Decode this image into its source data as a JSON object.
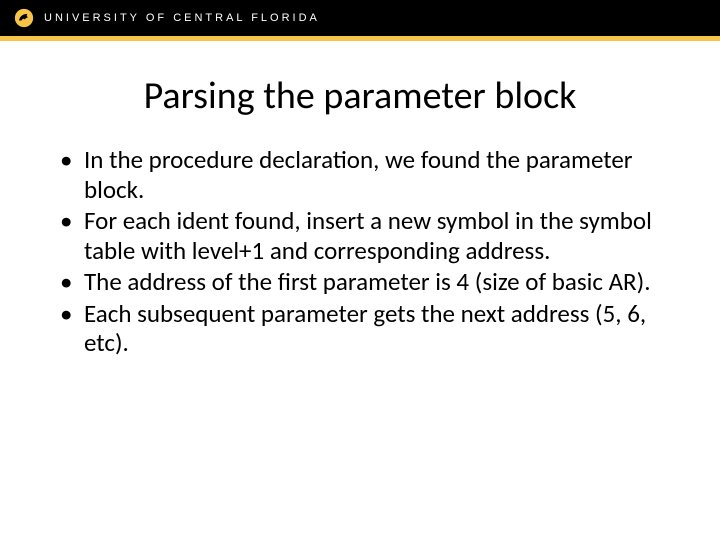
{
  "header": {
    "university": "UNIVERSITY OF CENTRAL FLORIDA"
  },
  "title": "Parsing the parameter block",
  "bullets": [
    "In the procedure declaration, we found the parameter block.",
    "For each ident found, insert a new symbol in the symbol table with level+1 and corresponding address.",
    "The address of the first parameter is 4 (size of basic AR).",
    "Each subsequent parameter gets the next address (5, 6, etc)."
  ]
}
